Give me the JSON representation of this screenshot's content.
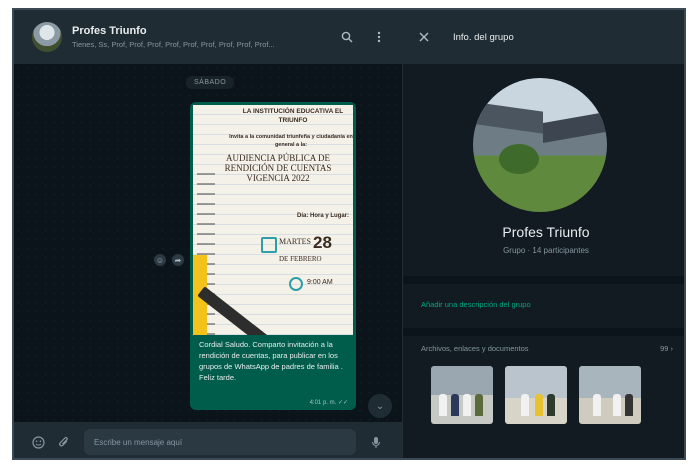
{
  "chat": {
    "name": "Profes Triunfo",
    "members": "Tienes, Ss, Prof, Prof, Prof, Prof, Prof, Prof, Prof, Prof, Prof...",
    "date_pill": "SÁBADO",
    "message": {
      "poster": {
        "school": "LA INSTITUCIÓN EDUCATIVA EL TRIUNFO",
        "invite": "Invita a la comunidad triunfeña y ciudadanía en general a la:",
        "event": "AUDIENCIA PÚBLICA DE RENDICIÓN DE CUENTAS VIGENCIA 2022",
        "time_heading": "Día: Hora y Lugar:",
        "day": "MARTES",
        "date": "28",
        "month": "DE FEBRERO",
        "hour": "9:00 AM"
      },
      "caption": "Cordial Saludo. Comparto invitación a la rendición de cuentas, para publicar en los grupos de WhatsApp de padres de familia . Feliz tarde.",
      "time": "4:01 p. m. ✓✓"
    },
    "input_placeholder": "Escribe un mensaje aquí"
  },
  "info": {
    "title": "Info. del grupo",
    "group_name": "Profes Triunfo",
    "group_subtitle": "Grupo · 14 participantes",
    "add_description": "Añadir una descripción del grupo",
    "media_label": "Archivos, enlaces y documentos",
    "media_count": "99"
  },
  "icons": {
    "search": "search-icon",
    "menu": "menu-icon",
    "close": "close-icon",
    "emoji": "emoji-icon",
    "attach": "attach-icon",
    "mic": "mic-icon"
  },
  "colors": {
    "bubble": "#005c4b",
    "accent": "#00a884",
    "background": "#0b141a",
    "panel": "#202c33"
  }
}
